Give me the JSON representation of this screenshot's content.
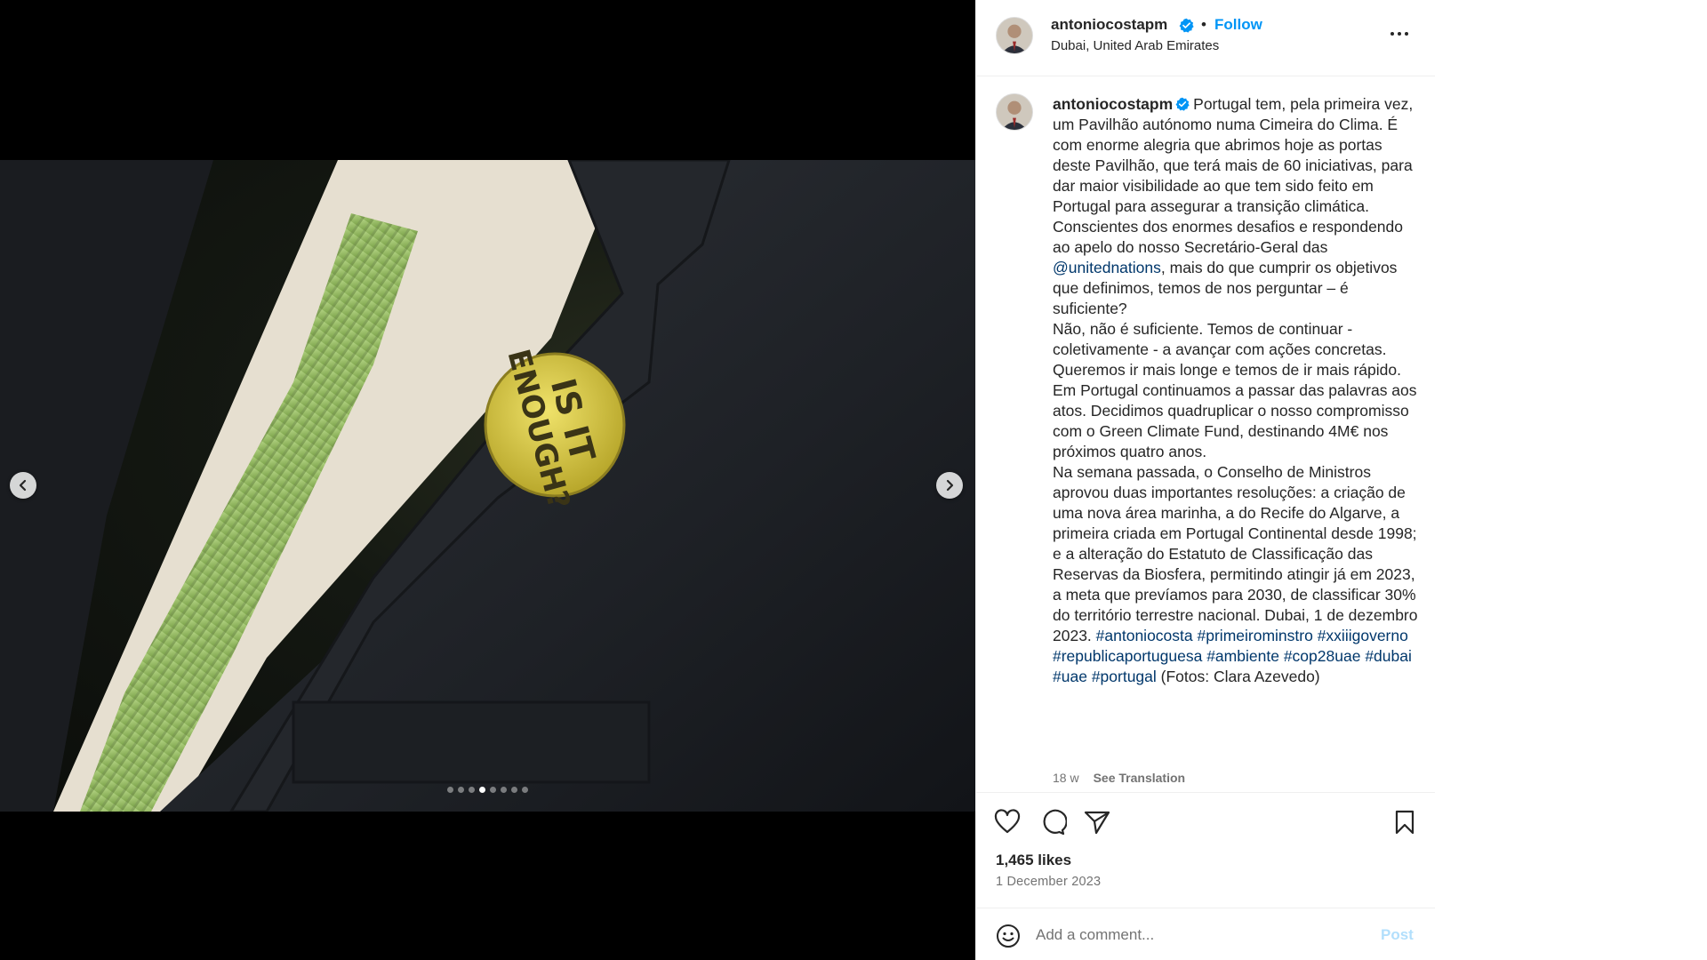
{
  "post": {
    "username": "antoniocostapm",
    "separator": "•",
    "follow_label": "Follow",
    "location": "Dubai, United Arab Emirates",
    "badge_text": [
      "IS IT",
      "ENOUGH?"
    ],
    "carousel": {
      "total": 8,
      "active_index": 3
    }
  },
  "caption": {
    "username": "antoniocostapm",
    "segments": [
      {
        "t": "Portugal tem, pela primeira vez, um Pavilhão autónomo numa Cimeira do Clima. É com enorme alegria que abrimos hoje as portas deste Pavilhão, que terá mais de 60 iniciativas, para dar maior visibilidade ao que tem sido feito em Portugal para assegurar a transição climática."
      },
      {
        "br": true
      },
      {
        "t": "Conscientes dos enormes desafios e respondendo ao apelo do nosso Secretário-Geral das "
      },
      {
        "link": "@unitednations"
      },
      {
        "t": ", mais do que cumprir os objetivos que definimos, temos de nos perguntar – é suficiente?"
      },
      {
        "br": true
      },
      {
        "t": "Não, não é suficiente. Temos de continuar - coletivamente - a avançar com ações concretas. Queremos ir mais longe e temos de ir mais rápido."
      },
      {
        "br": true
      },
      {
        "t": "Em Portugal continuamos a passar das palavras aos atos. Decidimos quadruplicar o nosso compromisso com o Green Climate Fund, destinando 4M€ nos próximos quatro anos."
      },
      {
        "br": true
      },
      {
        "t": "Na semana passada, o Conselho de Ministros aprovou duas importantes resoluções: a criação de uma nova área marinha, a do Recife do Algarve, a primeira criada em Portugal Continental desde 1998; e a alteração do Estatuto de Classificação das Reservas da Biosfera, permitindo atingir já em 2023, a meta que prevíamos para 2030, de classificar 30% do território terrestre nacional. Dubai, 1 de dezembro 2023. "
      },
      {
        "link": "#antoniocosta"
      },
      {
        "t": " "
      },
      {
        "link": "#primeirominstro"
      },
      {
        "t": " "
      },
      {
        "link": "#xxiiigoverno"
      },
      {
        "t": " "
      },
      {
        "link": "#republicaportuguesa"
      },
      {
        "t": " "
      },
      {
        "link": "#ambiente"
      },
      {
        "t": " "
      },
      {
        "link": "#cop28uae"
      },
      {
        "t": " "
      },
      {
        "link": "#dubai"
      },
      {
        "t": " "
      },
      {
        "link": "#uae"
      },
      {
        "t": " "
      },
      {
        "link": "#portugal"
      },
      {
        "t": " (Fotos: Clara Azevedo)"
      }
    ],
    "age": "18 w",
    "see_translation": "See Translation"
  },
  "engagement": {
    "likes": "1,465 likes",
    "date": "1 December 2023"
  },
  "comment_box": {
    "placeholder": "Add a comment...",
    "post_label": "Post"
  },
  "icons": {
    "prev": "chevron-left-icon",
    "next": "chevron-right-icon",
    "verified": "verified-badge-icon",
    "more": "more-horizontal-icon",
    "like": "heart-icon",
    "comment": "comment-bubble-icon",
    "share": "paper-plane-icon",
    "save": "bookmark-icon",
    "emoji": "emoji-smile-icon"
  },
  "colors": {
    "accent": "#0095f6",
    "link": "#00376b",
    "muted": "#737373",
    "post_disabled": "#b2dffc"
  }
}
